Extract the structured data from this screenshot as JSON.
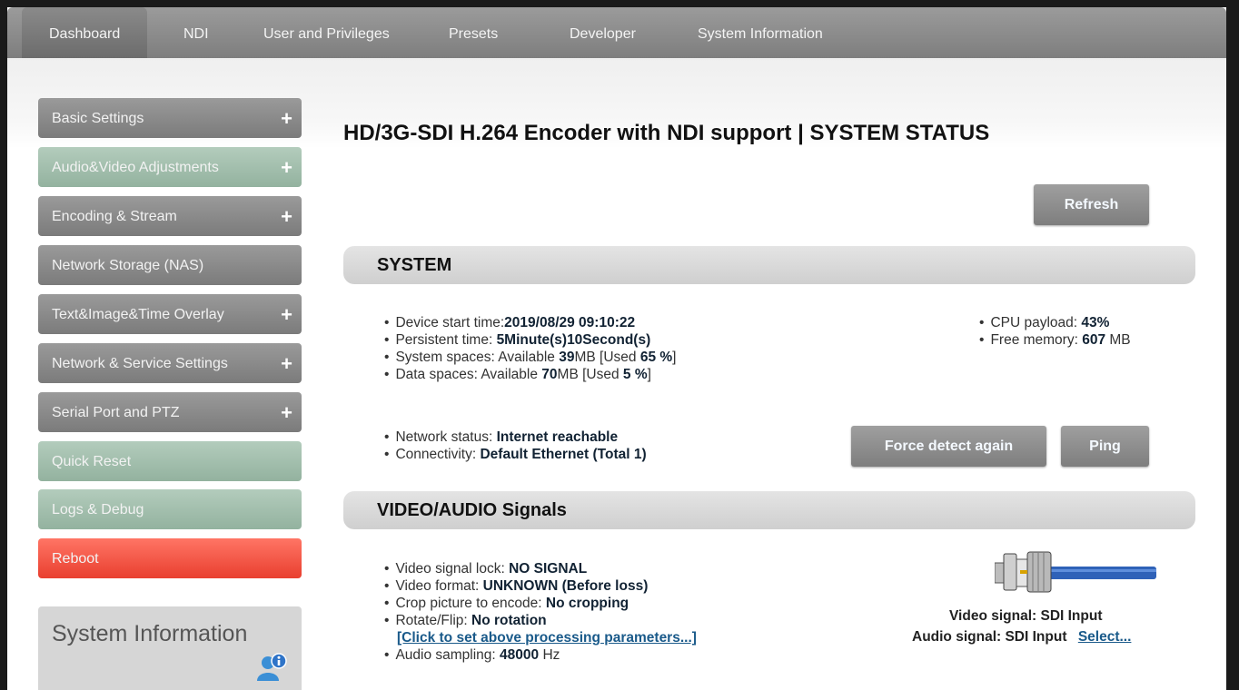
{
  "topnav": {
    "tabs": [
      {
        "label": "Dashboard"
      },
      {
        "label": "NDI"
      },
      {
        "label": "User and Privileges"
      },
      {
        "label": "Presets"
      },
      {
        "label": "Developer"
      },
      {
        "label": "System Information"
      }
    ]
  },
  "sidebar": {
    "items": [
      {
        "label": "Basic Settings",
        "expand": "+"
      },
      {
        "label": "Audio&Video Adjustments",
        "expand": "+"
      },
      {
        "label": "Encoding & Stream",
        "expand": "+"
      },
      {
        "label": "Network Storage (NAS)"
      },
      {
        "label": "Text&Image&Time Overlay",
        "expand": "+"
      },
      {
        "label": "Network & Service Settings",
        "expand": "+"
      },
      {
        "label": "Serial Port and PTZ",
        "expand": "+"
      },
      {
        "label": "Quick Reset"
      },
      {
        "label": "Logs & Debug"
      },
      {
        "label": "Reboot"
      }
    ],
    "system_info_title": "System Information",
    "system_info_icon": "user-info-icon"
  },
  "main": {
    "title": "HD/3G-SDI H.264 Encoder with NDI support | SYSTEM STATUS",
    "refresh_label": "Refresh",
    "system": {
      "heading": "SYSTEM",
      "device_start": {
        "label": "Device start time:",
        "value": "2019/08/29 09:10:22"
      },
      "persistent": {
        "label": "Persistent time: ",
        "value": "5Minute(s)10Second(s)"
      },
      "system_spaces": {
        "label": "System spaces: Available ",
        "avail": "39",
        "unit1": "MB [Used ",
        "used": "65 %",
        "close": "]"
      },
      "data_spaces": {
        "label": "Data spaces: Available ",
        "avail": "70",
        "unit1": "MB [Used ",
        "used": "5 %",
        "close": "]"
      },
      "cpu": {
        "label": "CPU payload: ",
        "value": "43%"
      },
      "memory": {
        "label": "Free memory: ",
        "value": "607",
        "unit": " MB"
      },
      "network_status": {
        "label": "Network status: ",
        "value": "Internet reachable"
      },
      "connectivity": {
        "label": "Connectivity: ",
        "value": "Default Ethernet (Total 1)"
      },
      "force_detect_label": "Force detect again",
      "ping_label": "Ping"
    },
    "signals": {
      "heading": "VIDEO/AUDIO Signals",
      "video_lock": {
        "label": "Video signal lock: ",
        "value": "NO SIGNAL"
      },
      "video_format": {
        "label": "Video format: ",
        "value": "UNKNOWN (Before loss)"
      },
      "crop": {
        "label": "Crop picture to encode: ",
        "value": "No cropping"
      },
      "rotate": {
        "label": "Rotate/Flip: ",
        "value": "No rotation"
      },
      "set_params_link": "[Click to set above processing parameters...]",
      "audio_sampling": {
        "label": "Audio sampling: ",
        "value": "48000",
        "unit": " Hz"
      },
      "video_signal": "Video signal: SDI Input",
      "audio_signal": "Audio signal: SDI Input",
      "select_link": "Select...",
      "connector_icon": "sdi-cable-icon"
    }
  }
}
